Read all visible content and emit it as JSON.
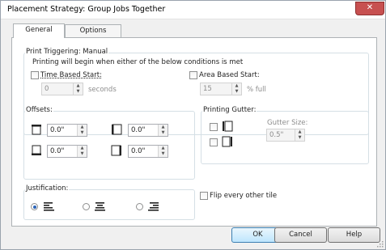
{
  "window": {
    "title": "Placement Strategy: Group Jobs Together"
  },
  "tabs": [
    {
      "label": "General",
      "active": true
    },
    {
      "label": "Options",
      "active": false
    }
  ],
  "print_triggering": {
    "title": "Print Triggering: Manual",
    "description": "Printing will begin when either of the below conditions is met",
    "time_based": {
      "label": "Time Based Start:",
      "checked": false,
      "value": "0",
      "unit": "seconds"
    },
    "area_based": {
      "label": "Area Based Start:",
      "checked": false,
      "value": "15",
      "unit": "% full"
    }
  },
  "offsets": {
    "title": "Offsets:",
    "top": "0.0\"",
    "left": "0.0\"",
    "bottom": "0.0\"",
    "right": "0.0\""
  },
  "printing_gutter": {
    "title": "Printing Gutter:",
    "gutter_size_label": "Gutter Size:",
    "gutter_size_value": "0.5\""
  },
  "justification": {
    "title": "Justification:",
    "selected": "left"
  },
  "flip_every_other_tile": {
    "label": "Flip every other tile",
    "checked": false
  },
  "buttons": {
    "ok": "OK",
    "cancel": "Cancel",
    "help": "Help"
  },
  "icons": {
    "close": "close-icon"
  }
}
